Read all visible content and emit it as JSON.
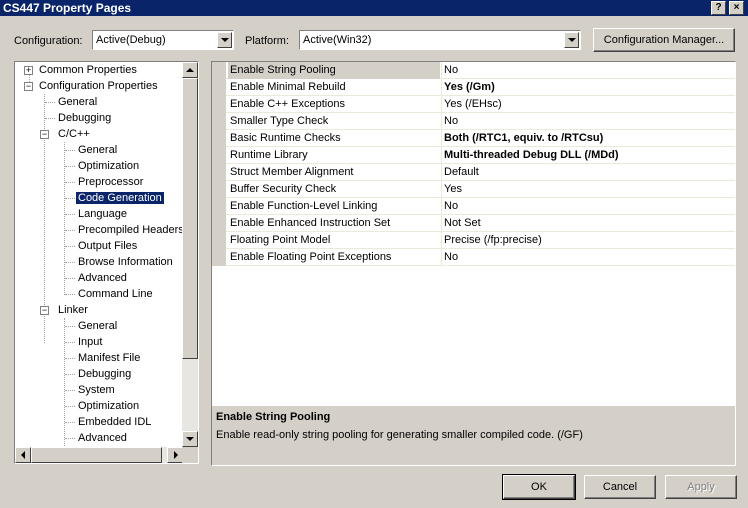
{
  "window": {
    "title": "CS447 Property Pages",
    "help_glyph": "?",
    "close_glyph": "×"
  },
  "config": {
    "configuration_label": "Configuration:",
    "configuration_value": "Active(Debug)",
    "platform_label": "Platform:",
    "platform_value": "Active(Win32)",
    "manager_button": "Configuration Manager..."
  },
  "tree": {
    "common_properties": "Common Properties",
    "configuration_properties": "Configuration Properties",
    "general": "General",
    "debugging": "Debugging",
    "cpp": "C/C++",
    "cpp_items": [
      "General",
      "Optimization",
      "Preprocessor",
      "Code Generation",
      "Language",
      "Precompiled Headers",
      "Output Files",
      "Browse Information",
      "Advanced",
      "Command Line"
    ],
    "linker": "Linker",
    "linker_items": [
      "General",
      "Input",
      "Manifest File",
      "Debugging",
      "System",
      "Optimization",
      "Embedded IDL",
      "Advanced"
    ],
    "selected": "Code Generation",
    "expand_glyph": "+",
    "collapse_glyph": "−"
  },
  "properties": [
    {
      "name": "Enable String Pooling",
      "value": "No",
      "bold": false,
      "selected": true
    },
    {
      "name": "Enable Minimal Rebuild",
      "value": "Yes (/Gm)",
      "bold": true
    },
    {
      "name": "Enable C++ Exceptions",
      "value": "Yes (/EHsc)",
      "bold": false
    },
    {
      "name": "Smaller Type Check",
      "value": "No",
      "bold": false
    },
    {
      "name": "Basic Runtime Checks",
      "value": "Both (/RTC1, equiv. to /RTCsu)",
      "bold": true
    },
    {
      "name": "Runtime Library",
      "value": "Multi-threaded Debug DLL (/MDd)",
      "bold": true
    },
    {
      "name": "Struct Member Alignment",
      "value": "Default",
      "bold": false
    },
    {
      "name": "Buffer Security Check",
      "value": "Yes",
      "bold": false
    },
    {
      "name": "Enable Function-Level Linking",
      "value": "No",
      "bold": false
    },
    {
      "name": "Enable Enhanced Instruction Set",
      "value": "Not Set",
      "bold": false
    },
    {
      "name": "Floating Point Model",
      "value": "Precise (/fp:precise)",
      "bold": false
    },
    {
      "name": "Enable Floating Point Exceptions",
      "value": "No",
      "bold": false
    }
  ],
  "description": {
    "title": "Enable String Pooling",
    "text": "Enable read-only string pooling for generating smaller compiled code.     (/GF)"
  },
  "buttons": {
    "ok": "OK",
    "cancel": "Cancel",
    "apply": "Apply"
  }
}
